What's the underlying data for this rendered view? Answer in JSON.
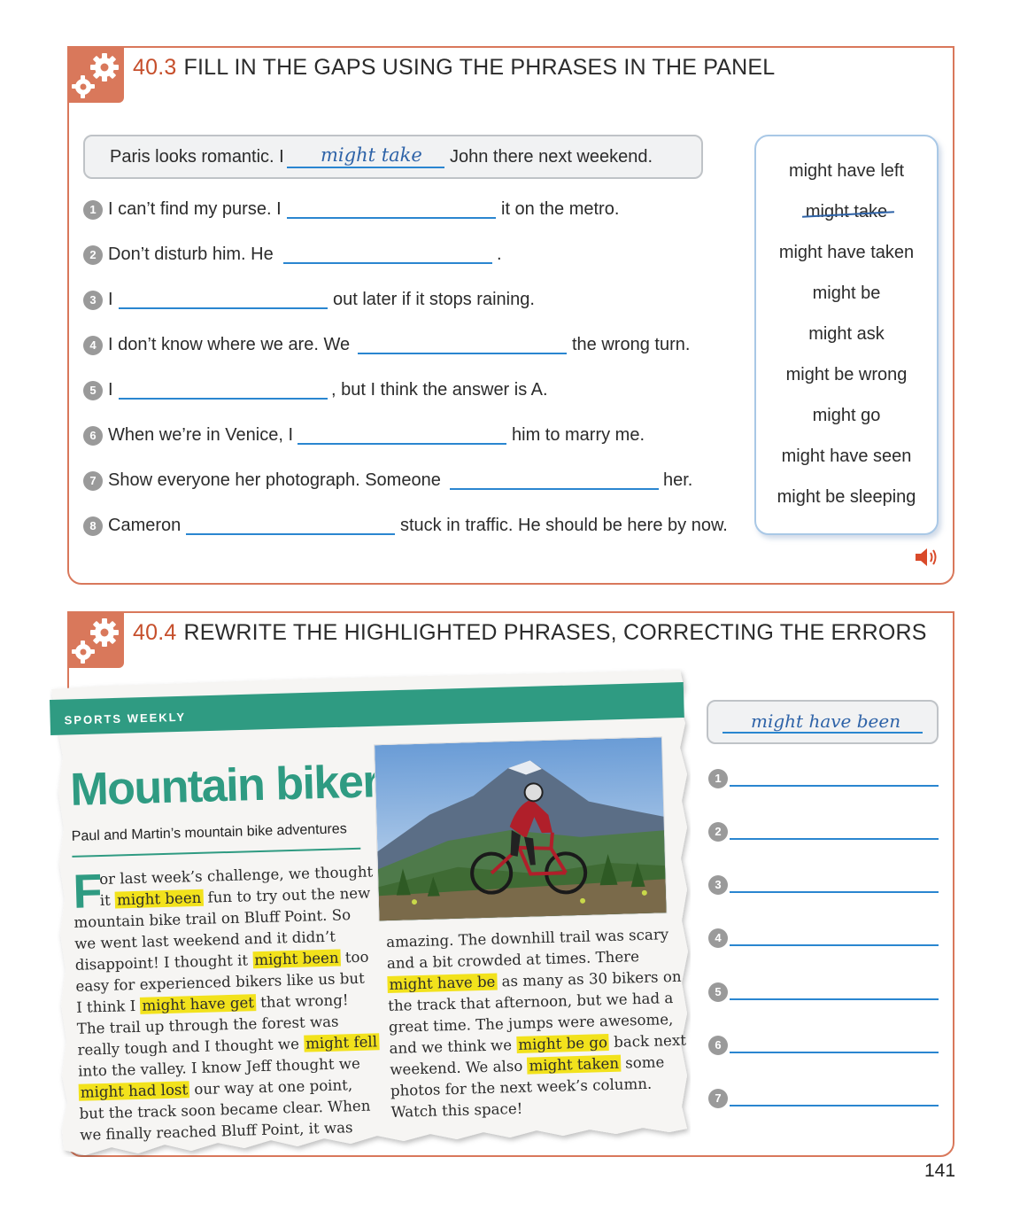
{
  "exercise_403": {
    "number": "40.3",
    "title": "FILL IN THE GAPS USING THE PHRASES IN THE PANEL",
    "example": {
      "before": "Paris looks romantic. I",
      "answer": "might take",
      "after": "John there next weekend."
    },
    "questions": [
      {
        "num": "1",
        "before": "I can’t find my purse. I",
        "after": "it on the metro."
      },
      {
        "num": "2",
        "before": "Don’t disturb him. He",
        "after": "."
      },
      {
        "num": "3",
        "before": "I",
        "after": "out later if it stops raining."
      },
      {
        "num": "4",
        "before": "I don’t know where we are. We",
        "after": "the wrong turn."
      },
      {
        "num": "5",
        "before": "I",
        "after": ", but I think the answer is A."
      },
      {
        "num": "6",
        "before": "When we’re in Venice, I",
        "after": "him to marry me."
      },
      {
        "num": "7",
        "before": "Show everyone her photograph. Someone",
        "after": "her."
      },
      {
        "num": "8",
        "before": "Cameron",
        "after": "stuck in traffic. He should be here by now."
      }
    ],
    "panel": [
      "might have left",
      "might take",
      "might have taken",
      "might be",
      "might ask",
      "might be wrong",
      "might go",
      "might have seen",
      "might be sleeping"
    ],
    "panel_struck_item": "might take",
    "audio_icon": "speaker-icon"
  },
  "exercise_404": {
    "number": "40.4",
    "title": "REWRITE THE HIGHLIGHTED PHRASES, CORRECTING THE ERRORS",
    "article": {
      "banner": "SPORTS WEEKLY",
      "headline": "Mountain biker",
      "subhead": "Paul and Martin’s mountain bike adventures",
      "dropcap": "F",
      "photo_description": "mountain-biker-photo",
      "col1": [
        [
          "or last week’s challenge, we thought"
        ],
        [
          "it ",
          "might been",
          " fun to try out the new"
        ],
        [
          "mountain bike trail on Bluff Point. So"
        ],
        [
          "we went last weekend and it didn’t"
        ],
        [
          "disappoint! I thought it ",
          "might been",
          " too"
        ],
        [
          "easy for experienced bikers like us but"
        ],
        [
          "I think I ",
          "might have get",
          " that wrong!"
        ],
        [
          "The trail up through the forest was"
        ],
        [
          "really tough and I thought we ",
          "might fell"
        ],
        [
          "into the valley. I know Jeff thought we"
        ],
        [
          "",
          "might had lost",
          " our way at one point,"
        ],
        [
          "but the track soon became clear. When"
        ],
        [
          "we finally reached Bluff Point, it was"
        ]
      ],
      "col2": [
        [
          "amazing. The downhill trail was scary"
        ],
        [
          "and a bit crowded at times. There"
        ],
        [
          "",
          "might have be",
          " as many as 30 bikers on"
        ],
        [
          "the track that afternoon, but we had a"
        ],
        [
          "great time. The jumps were awesome,"
        ],
        [
          "and we think we ",
          "might be go",
          " back next"
        ],
        [
          "weekend. We also ",
          "might taken",
          " some"
        ],
        [
          "photos for the next week’s column."
        ],
        [
          "Watch this space!"
        ]
      ]
    },
    "example_answer": "might have been",
    "answer_numbers": [
      "1",
      "2",
      "3",
      "4",
      "5",
      "6",
      "7"
    ]
  },
  "page_number": "141",
  "colors": {
    "section_accent": "#d9785b",
    "number_red": "#c64f2c",
    "teal": "#2f9b82",
    "highlight": "#f2e21c",
    "answer_blue": "#2e63a8",
    "gap_line": "#2a86d0"
  }
}
